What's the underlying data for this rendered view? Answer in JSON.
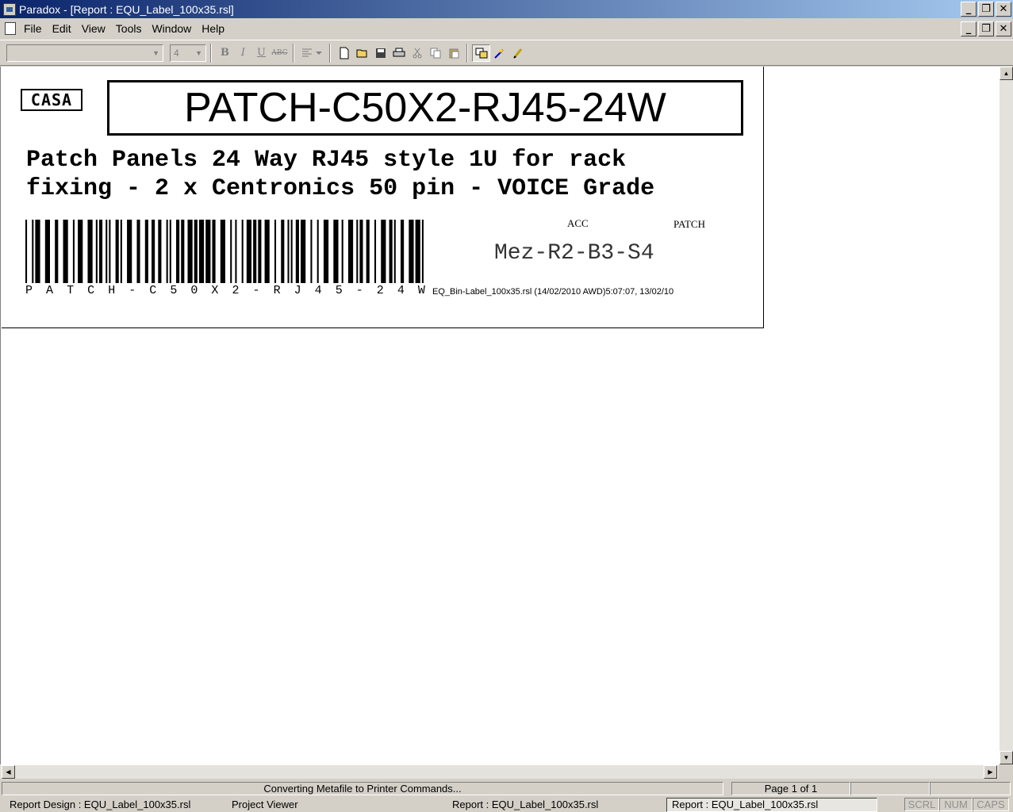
{
  "window": {
    "title": "Paradox - [Report : EQU_Label_100x35.rsl]",
    "controls": {
      "minimize": "_",
      "restore": "❐",
      "close": "✕"
    }
  },
  "menu": {
    "items": [
      "File",
      "Edit",
      "View",
      "Tools",
      "Window",
      "Help"
    ]
  },
  "toolbar": {
    "font_name": "",
    "font_size": "4",
    "bold": "B",
    "italic": "I",
    "underline": "U",
    "strike": "ABC"
  },
  "label": {
    "logo": "CASA",
    "part_number": "PATCH-C50X2-RJ45-24W",
    "description_line1": "Patch Panels 24 Way RJ45 style 1U for rack",
    "description_line2": "fixing - 2 x Centronics 50 pin - VOICE Grade",
    "barcode_chars": [
      "P",
      "A",
      "T",
      "C",
      "H",
      "-",
      "C",
      "5",
      "0",
      "X",
      "2",
      "-",
      "R",
      "J",
      "4",
      "5",
      "-",
      "2",
      "4",
      "W"
    ],
    "acc": "ACC",
    "patch": "PATCH",
    "location": "Mez-R2-B3-S4",
    "footer": "EQ_Bin-Label_100x35.rsl (14/02/2010  AWD)5:07:07, 13/02/10"
  },
  "status": {
    "message": "Converting Metafile to Printer Commands...",
    "page": "Page 1 of 1"
  },
  "taskbar": {
    "tasks": [
      "Report Design : EQU_Label_100x35.rsl",
      "Project Viewer",
      "Report : EQU_Label_100x35.rsl",
      "Report : EQU_Label_100x35.rsl"
    ],
    "indicators": [
      "SCRL",
      "NUM",
      "CAPS"
    ]
  }
}
